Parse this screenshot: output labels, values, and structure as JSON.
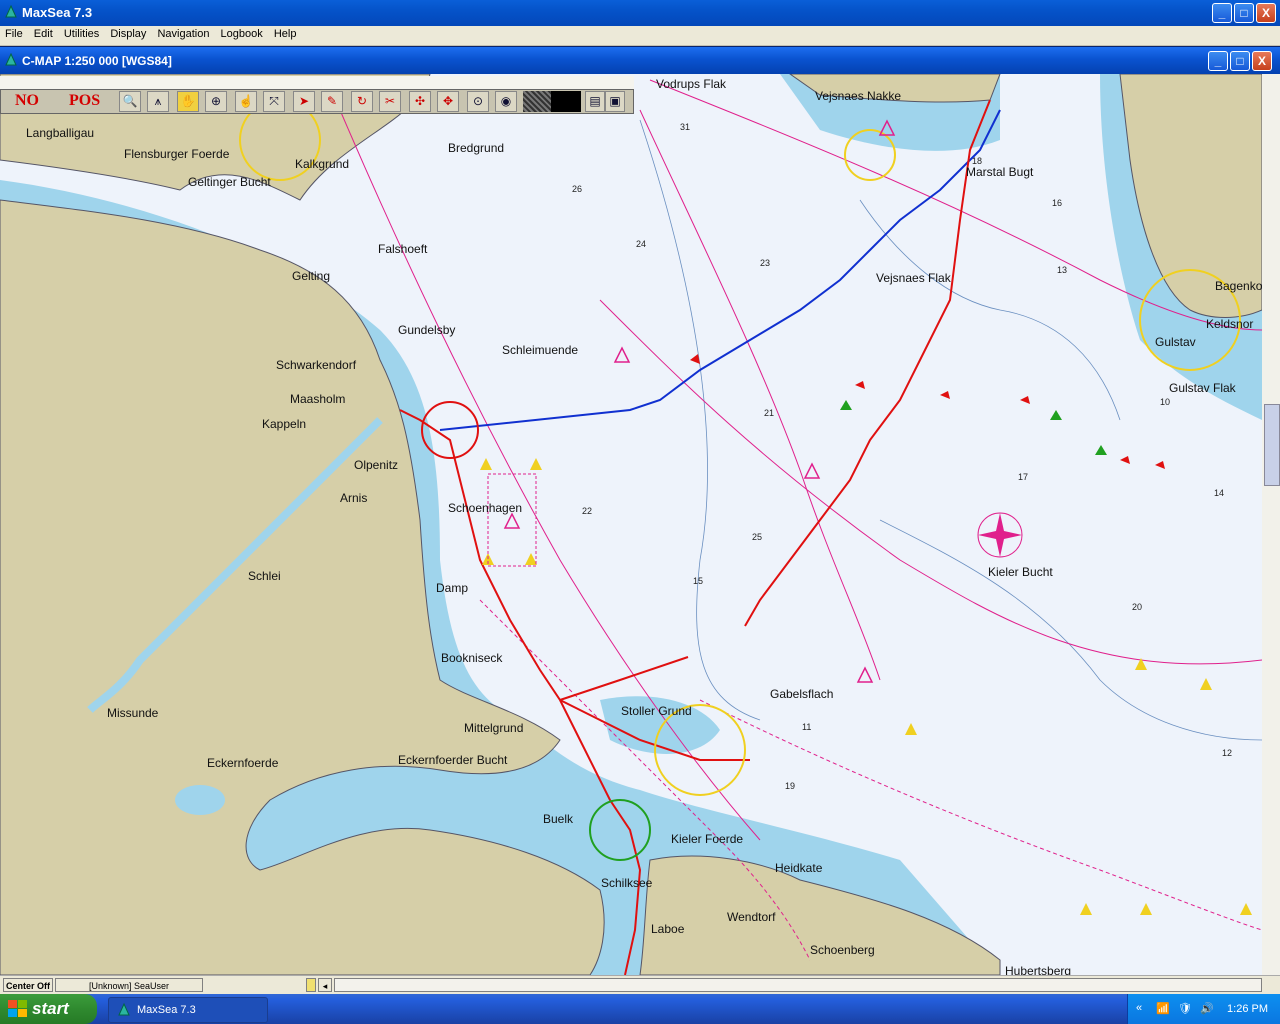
{
  "app": {
    "title": "MaxSea 7.3"
  },
  "window_buttons": {
    "minimize": "_",
    "maximize": "□",
    "close": "X"
  },
  "menu": [
    "File",
    "Edit",
    "Utilities",
    "Display",
    "Navigation",
    "Logbook",
    "Help"
  ],
  "chart_window": {
    "title": "C-MAP  1:250 000 [WGS84]"
  },
  "toolbar": {
    "no_label": "NO",
    "pos_label": "POS",
    "tools": [
      "zoom-icon",
      "compass-divider-icon",
      "pan-hand-icon",
      "crosshair-icon",
      "grab-hand-icon",
      "route-tool-icon",
      "pointer-icon",
      "pencil-icon",
      "rotate-icon",
      "scissors-icon",
      "mark-tool-icon",
      "move-icon",
      "circle-dot-icon",
      "target-icon"
    ]
  },
  "map": {
    "place_labels": [
      "Langballigau",
      "Flensburger Foerde",
      "Kalkgrund",
      "Geltinger Bucht",
      "Bredgrund",
      "Vodrups Flak",
      "Vejsnaes Nakke",
      "Marstal Bugt",
      "Falshoeft",
      "Gelting",
      "Vejsnaes Flak",
      "Bagenkop",
      "Keldsnor",
      "Gulstav",
      "Gulstav Flak",
      "Gundelsby",
      "Schleimuende",
      "Schwarkendorf",
      "Maasholm",
      "Kappeln",
      "Olpenitz",
      "Arnis",
      "Schoenhagen",
      "Kieler Bucht",
      "Schlei",
      "Damp",
      "Bookniseck",
      "Gabelsflach",
      "Missunde",
      "Stoller Grund",
      "Mittelgrund",
      "Eckernfoerder Bucht",
      "Eckernfoerde",
      "Buelk",
      "Kieler Foerde",
      "Heidkate",
      "Schilksee",
      "Wendtorf",
      "Laboe",
      "Schoenberg",
      "Hubertsberg"
    ],
    "depth_soundings": [
      "31",
      "13",
      "24",
      "16",
      "18",
      "26",
      "23",
      "21",
      "22",
      "15",
      "19",
      "17",
      "20",
      "11",
      "25",
      "12",
      "10",
      "14"
    ]
  },
  "status": {
    "mode": "Center Off",
    "user": "[Unknown] SeaUser"
  },
  "taskbar": {
    "start": "start",
    "task_label": "MaxSea 7.3",
    "clock": "1:26 PM"
  },
  "colors": {
    "land": "#d6cfa8",
    "water_shallow": "#9fd4ec",
    "water_deep": "#eef3fb",
    "route_red": "#e01010",
    "route_blue": "#1030d0",
    "eez": "#e0208c"
  }
}
